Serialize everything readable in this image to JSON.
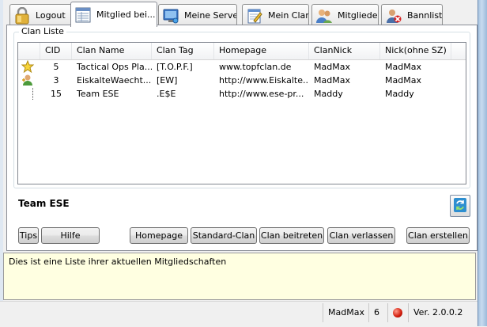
{
  "tabs": [
    {
      "label": "Logout",
      "icon": "padlock-icon"
    },
    {
      "label": "Mitglied bei...",
      "icon": "membership-list-icon",
      "active": true
    },
    {
      "label": "Meine Server",
      "icon": "server-icon"
    },
    {
      "label": "Mein Clan",
      "icon": "notepad-pencil-icon"
    },
    {
      "label": "Mitglieder",
      "icon": "members-icon"
    },
    {
      "label": "Bannliste",
      "icon": "ban-user-icon"
    }
  ],
  "group": {
    "title": "Clan Liste"
  },
  "table": {
    "columns": [
      "CID",
      "Clan Name",
      "Clan Tag",
      "Homepage",
      "ClanNick",
      "Nick(ohne SZ)"
    ],
    "rows": [
      {
        "icon": "star-icon",
        "cid": "5",
        "name": "Tactical Ops Pla...",
        "tag": "[T.O.P.F.]",
        "homepage": "www.topfclan.de",
        "clannick": "MadMax",
        "nick": "MadMax"
      },
      {
        "icon": "user-add-icon",
        "cid": "3",
        "name": "EiskalteWaecht...",
        "tag": "[EW]",
        "homepage": "http://www.Eiskalte...",
        "clannick": "MadMax",
        "nick": "MadMax"
      },
      {
        "icon": "",
        "cid": "15",
        "name": "Team ESE",
        "tag": ".E$E",
        "homepage": "http://www.ese-pr...",
        "clannick": "Maddy",
        "nick": "Maddy"
      }
    ]
  },
  "selected_clan": "Team ESE",
  "buttons": {
    "tips": "Tips",
    "hilfe": "Hilfe",
    "homepage": "Homepage",
    "standard": "Standard-Clan",
    "beitreten": "Clan beitreten",
    "verlassen": "Clan verlassen",
    "erstellen": "Clan erstellen"
  },
  "info_text": "Dies ist eine Liste ihrer aktuellen Mitgliedschaften",
  "status": {
    "user": "MadMax",
    "count": "6",
    "version": "Ver. 2.0.0.2"
  }
}
